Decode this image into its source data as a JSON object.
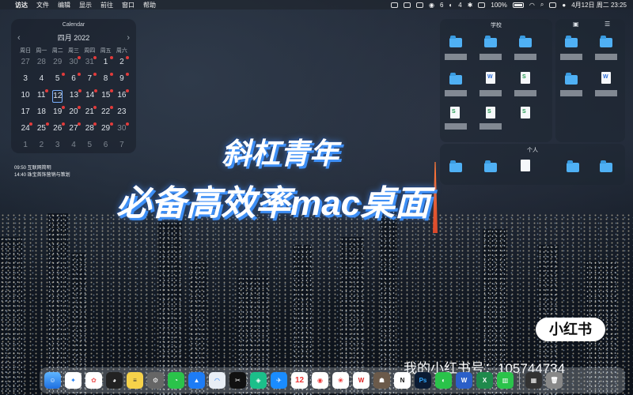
{
  "menubar": {
    "apple": "",
    "app_name": "访达",
    "menus": [
      "文件",
      "编辑",
      "显示",
      "前往",
      "窗口",
      "帮助"
    ],
    "status_items": [
      "6",
      "4"
    ],
    "battery": "100%",
    "datetime": "4月12日 周二 23:25"
  },
  "calendar": {
    "title": "Calendar",
    "month": "四月 2022",
    "prev": "‹",
    "next": "›",
    "dows": [
      "周日",
      "周一",
      "周二",
      "周三",
      "周四",
      "周五",
      "周六"
    ],
    "weeks": [
      [
        "27",
        "28",
        "29",
        "30",
        "31",
        "1",
        "2"
      ],
      [
        "3",
        "4",
        "5",
        "6",
        "7",
        "8",
        "9"
      ],
      [
        "10",
        "11",
        "12",
        "13",
        "14",
        "15",
        "16"
      ],
      [
        "17",
        "18",
        "19",
        "20",
        "21",
        "22",
        "23"
      ],
      [
        "24",
        "25",
        "26",
        "27",
        "28",
        "29",
        "30"
      ],
      [
        "1",
        "2",
        "3",
        "4",
        "5",
        "6",
        "7"
      ]
    ],
    "today": "12",
    "events": [
      "09:50 互联网简明",
      "14:40 珠宝首饰营销与策划"
    ]
  },
  "folders": {
    "school_title": "学校",
    "personal_title": "个人"
  },
  "headline": {
    "line1": "斜杠青年",
    "line2": "必备高效率mac桌面"
  },
  "badge": "小红书",
  "contact": "我的小红书号：105744734",
  "dock": {
    "calendar_day": "12",
    "wps": "W",
    "notion": "N",
    "ps": "Ps",
    "word": "W",
    "excel": "X"
  },
  "colors": {
    "accent": "#3d8ef5",
    "folder": "#4fb0f4",
    "event_dot": "#e23b3b"
  }
}
